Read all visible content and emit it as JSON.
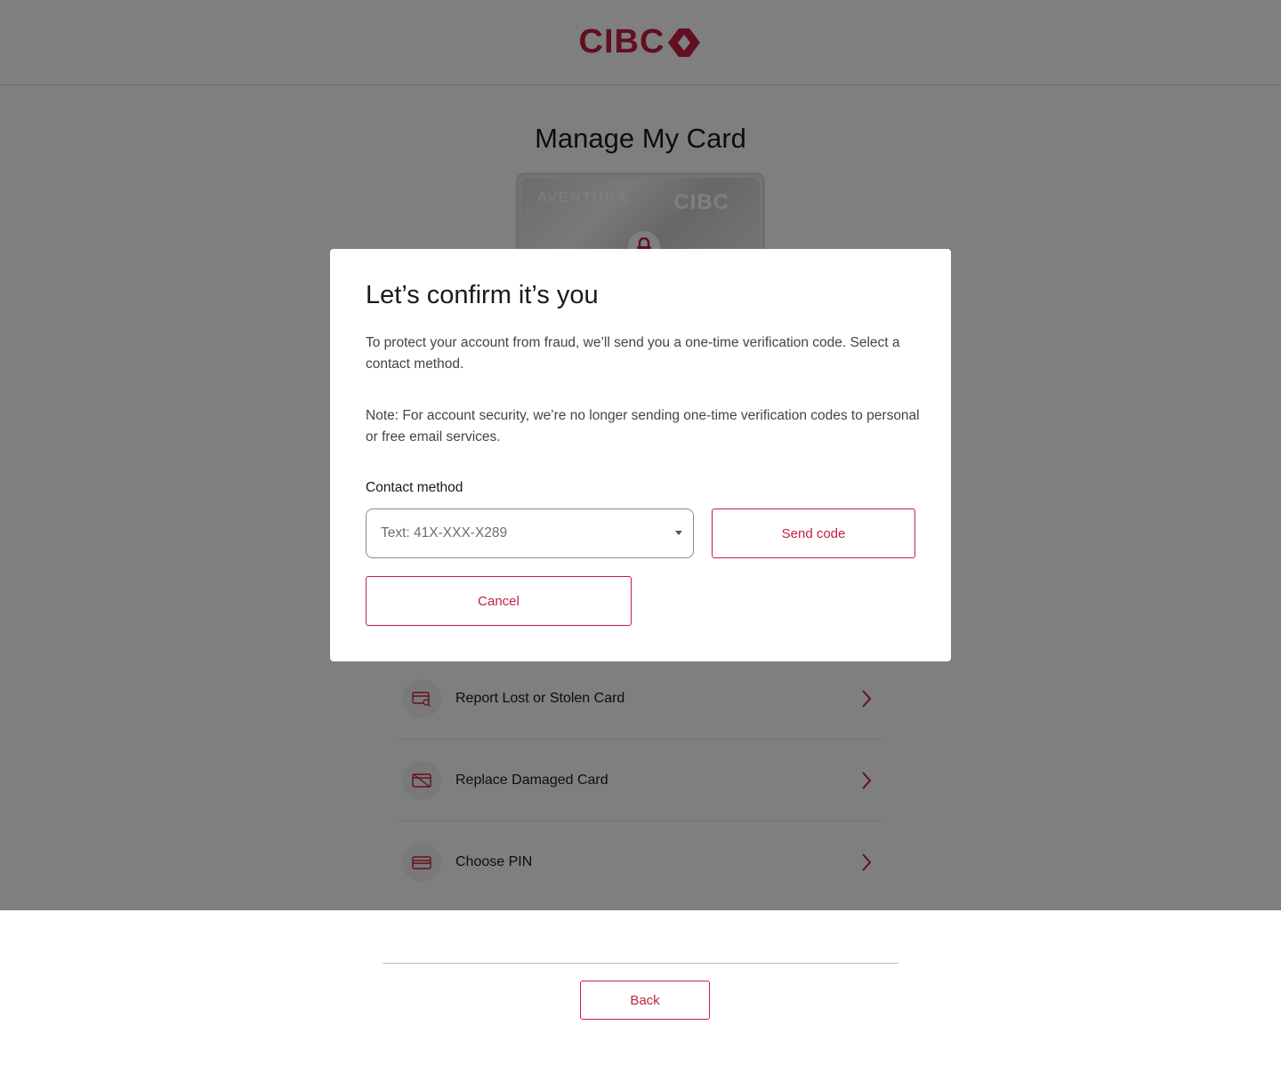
{
  "header": {
    "logo_text": "CIBC"
  },
  "page": {
    "title": "Manage My Card",
    "card": {
      "brand": "AVENTURA",
      "bank": "CIBC"
    },
    "options": [
      {
        "label": "Report Lost or Stolen Card",
        "icon": "card-search-icon"
      },
      {
        "label": "Replace Damaged Card",
        "icon": "card-damaged-icon"
      },
      {
        "label": "Choose PIN",
        "icon": "card-icon"
      }
    ],
    "back_label": "Back"
  },
  "modal": {
    "title": "Let’s confirm it’s you",
    "paragraph1": "To protect your account from fraud, we’ll send you a one-time verification code. Select a contact method.",
    "paragraph2": "Note: For account security, we’re no longer sending one-time verification codes to personal or free email services.",
    "contact_label": "Contact method",
    "contact_value": "Text: 41X-XXX-X289",
    "send_label": "Send code",
    "cancel_label": "Cancel"
  },
  "colors": {
    "brand": "#c41f3e",
    "overlay": "rgba(0,0,0,0.5)"
  }
}
